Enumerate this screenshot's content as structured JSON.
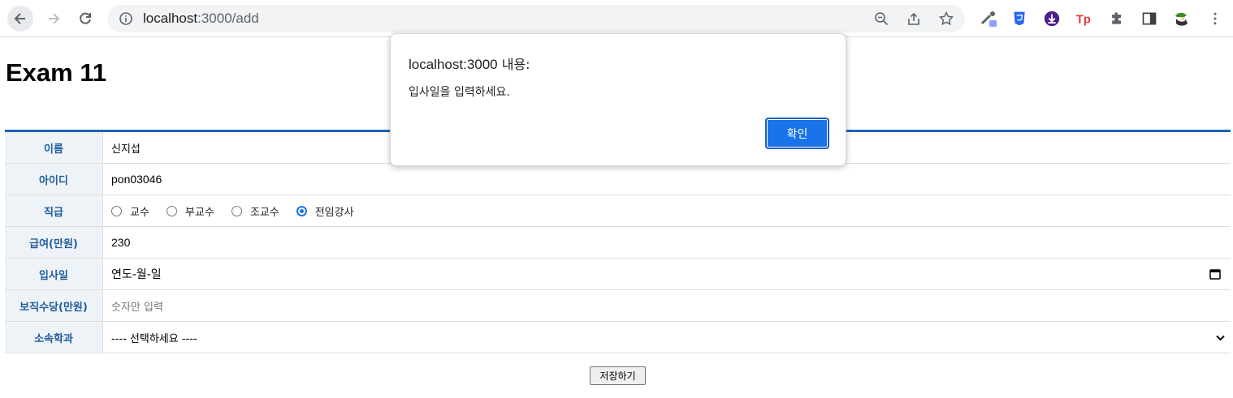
{
  "browser": {
    "url_host": "localhost",
    "url_path": ":3000/add"
  },
  "page": {
    "title": "Exam 11",
    "fields": {
      "name_label": "이름",
      "name_value": "신지섭",
      "id_label": "아이디",
      "id_value": "pon03046",
      "rank_label": "직급",
      "rank_options": [
        "교수",
        "부교수",
        "조교수",
        "전임강사"
      ],
      "rank_selected": "전임강사",
      "salary_label": "급여(만원)",
      "salary_value": "230",
      "hiredate_label": "입사일",
      "hiredate_placeholder": "연도-월-일",
      "allowance_label": "보직수당(만원)",
      "allowance_placeholder": "숫자만 입력",
      "dept_label": "소속학과",
      "dept_selected": "---- 선택하세요 ----"
    },
    "save_label": "저장하기"
  },
  "dialog": {
    "title_host": "localhost:3000",
    "title_suffix": " 내용:",
    "message": "입사일을 입력하세요.",
    "ok_label": "확인"
  },
  "colors": {
    "accent": "#1f63b8",
    "label_text": "#1f5d9c",
    "label_bg": "#eef3f8",
    "dialog_button": "#1a73e8"
  }
}
